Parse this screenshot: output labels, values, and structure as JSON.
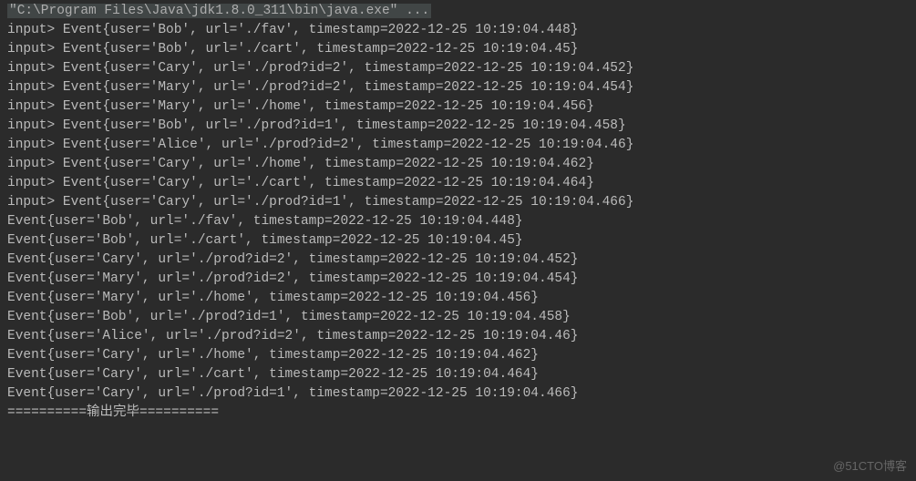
{
  "header": {
    "command": "\"C:\\Program Files\\Java\\jdk1.8.0_311\\bin\\java.exe\" ..."
  },
  "lines": [
    "input> Event{user='Bob', url='./fav', timestamp=2022-12-25 10:19:04.448}",
    "input> Event{user='Bob', url='./cart', timestamp=2022-12-25 10:19:04.45}",
    "input> Event{user='Cary', url='./prod?id=2', timestamp=2022-12-25 10:19:04.452}",
    "input> Event{user='Mary', url='./prod?id=2', timestamp=2022-12-25 10:19:04.454}",
    "input> Event{user='Mary', url='./home', timestamp=2022-12-25 10:19:04.456}",
    "input> Event{user='Bob', url='./prod?id=1', timestamp=2022-12-25 10:19:04.458}",
    "input> Event{user='Alice', url='./prod?id=2', timestamp=2022-12-25 10:19:04.46}",
    "input> Event{user='Cary', url='./home', timestamp=2022-12-25 10:19:04.462}",
    "input> Event{user='Cary', url='./cart', timestamp=2022-12-25 10:19:04.464}",
    "input> Event{user='Cary', url='./prod?id=1', timestamp=2022-12-25 10:19:04.466}",
    "Event{user='Bob', url='./fav', timestamp=2022-12-25 10:19:04.448}",
    "Event{user='Bob', url='./cart', timestamp=2022-12-25 10:19:04.45}",
    "Event{user='Cary', url='./prod?id=2', timestamp=2022-12-25 10:19:04.452}",
    "Event{user='Mary', url='./prod?id=2', timestamp=2022-12-25 10:19:04.454}",
    "Event{user='Mary', url='./home', timestamp=2022-12-25 10:19:04.456}",
    "Event{user='Bob', url='./prod?id=1', timestamp=2022-12-25 10:19:04.458}",
    "Event{user='Alice', url='./prod?id=2', timestamp=2022-12-25 10:19:04.46}",
    "Event{user='Cary', url='./home', timestamp=2022-12-25 10:19:04.462}",
    "Event{user='Cary', url='./cart', timestamp=2022-12-25 10:19:04.464}",
    "Event{user='Cary', url='./prod?id=1', timestamp=2022-12-25 10:19:04.466}",
    "==========输出完毕=========="
  ],
  "watermark": "@51CTO博客"
}
